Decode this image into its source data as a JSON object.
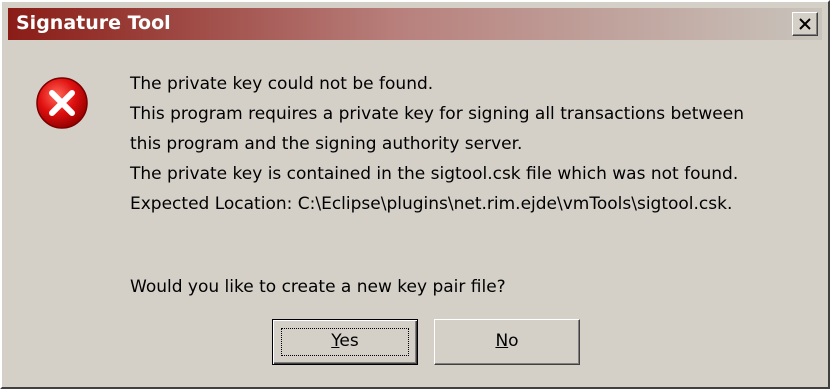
{
  "window": {
    "title": "Signature Tool"
  },
  "titlebar": {
    "close_label": "X",
    "gradient_start": "#8a1c16",
    "gradient_end": "#c8c4bc"
  },
  "icon": {
    "name": "error-icon",
    "color": "#d80000"
  },
  "message": {
    "lines": [
      "The private key could not be found.",
      "This program requires a private key for signing all transactions between",
      "this program and the signing authority server.",
      "The private key is contained in the sigtool.csk file which was not found.",
      "Expected Location: C:\\Eclipse\\plugins\\net.rim.ejde\\vmTools\\sigtool.csk."
    ],
    "question": "Would you like to create a new key pair file?"
  },
  "buttons": {
    "yes": {
      "mnemonic": "Y",
      "rest": "es"
    },
    "no": {
      "mnemonic": "N",
      "rest": "o"
    }
  }
}
